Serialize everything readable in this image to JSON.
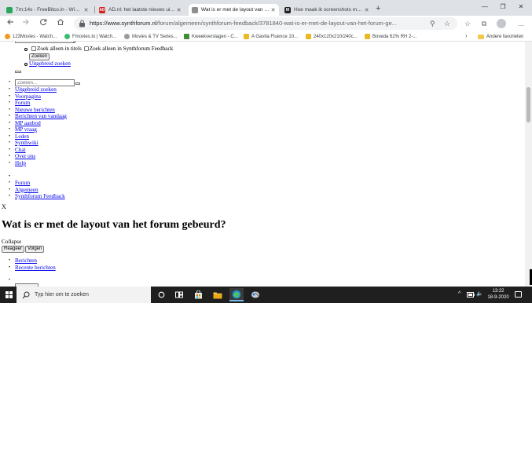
{
  "browser": {
    "tabs": [
      {
        "label": "7m:14s - FreeBitco.in - Win free",
        "favicon_color": "#2aa65c",
        "active": false
      },
      {
        "label": "AD.nl: het laatste nieuws uit bin",
        "favicon_color": "#d1211a",
        "favicon_text": "AD",
        "active": false
      },
      {
        "label": "Wat is er met de layout van het f",
        "favicon_color": "#8e8e8e",
        "active": true
      },
      {
        "label": "Hoe maak ik screenshots met u",
        "favicon_color": "#222222",
        "favicon_text": "M",
        "active": false
      }
    ],
    "new_tab_symbol": "+",
    "window_controls": {
      "minimize": "—",
      "maximize": "❐",
      "close": "✕"
    },
    "address": {
      "host": "https://www.synthforum.nl",
      "path": "/forum/algemeen/synthforum-feedback/3781840-wat-is-er-met-de-layout-van-het-forum-ge..."
    },
    "bookmarks": [
      {
        "label": "123Movies - Watch...",
        "color": "#f29a1f"
      },
      {
        "label": "Fmovies.to | Watch...",
        "color": "#3dbb6e"
      },
      {
        "label": "Movies & TV Series...",
        "color": "#9b9b9b"
      },
      {
        "label": "Kweekverslagen - C...",
        "color": "#3d8e35"
      },
      {
        "label": "A Gavita Fluence 10...",
        "color": "#e8b923"
      },
      {
        "label": "240x120x210/240c...",
        "color": "#e8b923"
      },
      {
        "label": "Boveda 62% RH 2-...",
        "color": "#e8b923"
      }
    ],
    "other_bookmarks": "Andere favorieten"
  },
  "page": {
    "search_options": {
      "titles_only": "Zoek alleen in titels",
      "synthforum_feedback_only": "Zoek alleen in Synthforum Feedback",
      "search_button": "Zoeken",
      "advanced_search": "Uitgebreid zoeken"
    },
    "search_input": {
      "placeholder": "Zoeken..."
    },
    "nav_links": [
      "Uitgebreid zoeken",
      "Voorpagina",
      "Forum",
      "Nieuwe berichten",
      "Berichten van vandaag",
      "MP aanbod",
      "MP vraag",
      "Leden",
      "Synthwiki",
      "Chat",
      "Over ons",
      "Help"
    ],
    "breadcrumbs": [
      "Forum",
      "Algemeen",
      "Synthforum Feedback"
    ],
    "close_glyph": "X",
    "post_title": "Wat is er met de layout van het forum gebeurd?",
    "collapse_label": "Collapse",
    "reply_button": "Reageer",
    "follow_button": "Volgen",
    "sub_tabs": [
      "Berichten",
      "Recente berichten"
    ]
  },
  "taskbar": {
    "search_placeholder": "Typ hier om te zoeken",
    "time": "13:22",
    "date": "18-9-2020",
    "tray_chevron": "^",
    "tray_volume": "🔈"
  }
}
